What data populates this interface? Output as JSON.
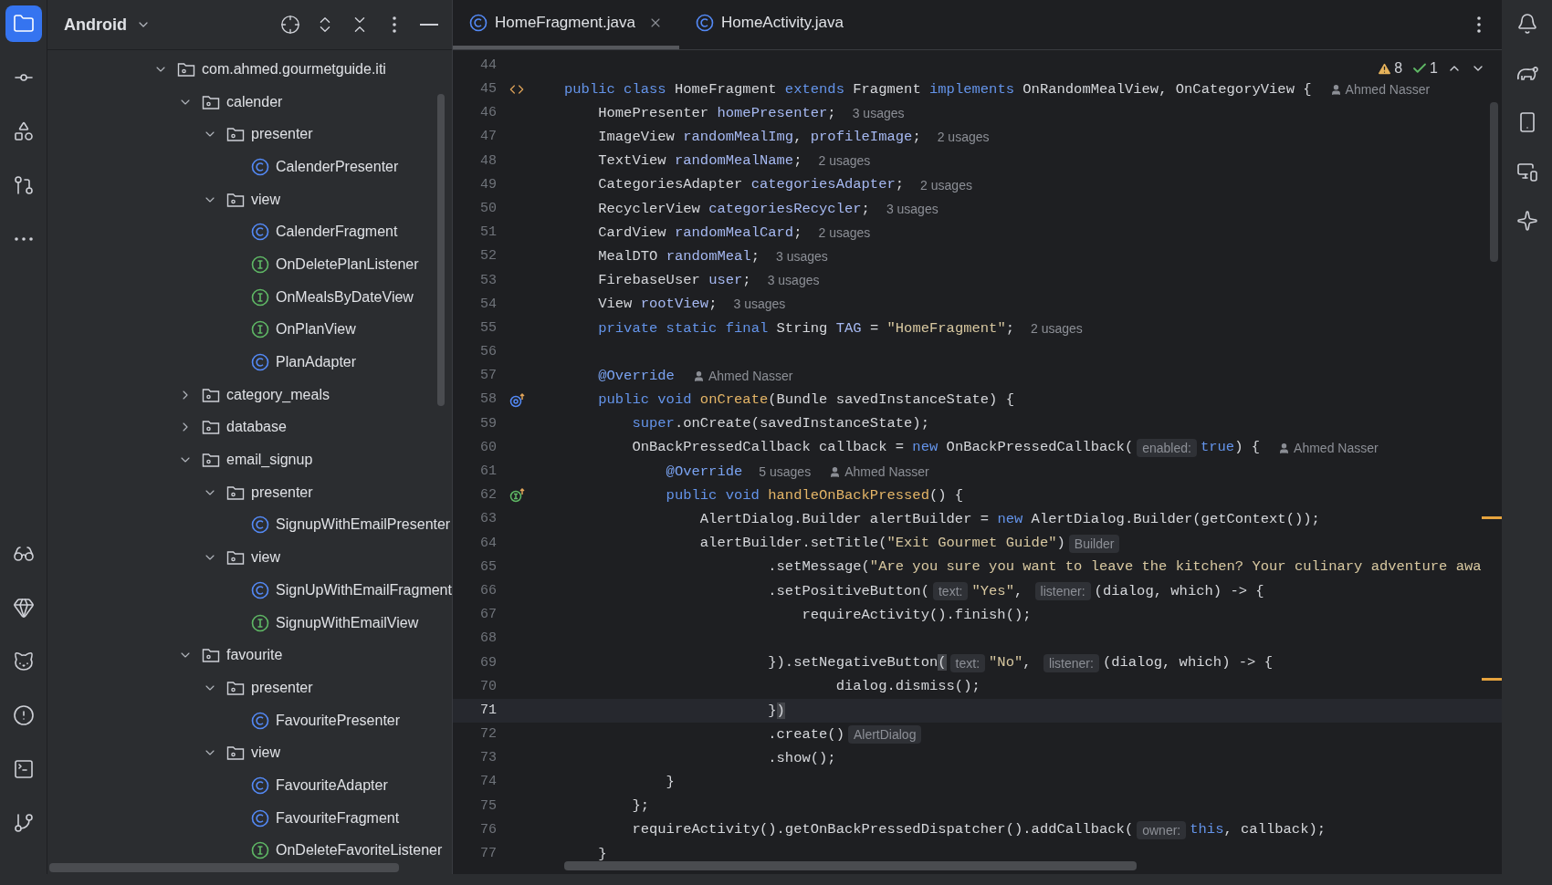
{
  "project_panel": {
    "title": "Android",
    "tree": [
      {
        "label": "com.ahmed.gourmetguide.iti",
        "kind": "folder",
        "expanded": true,
        "children": [
          {
            "label": "calender",
            "kind": "folder",
            "expanded": true,
            "children": [
              {
                "label": "presenter",
                "kind": "folder",
                "expanded": true,
                "children": [
                  {
                    "label": "CalenderPresenter",
                    "kind": "class"
                  }
                ]
              },
              {
                "label": "view",
                "kind": "folder",
                "expanded": true,
                "children": [
                  {
                    "label": "CalenderFragment",
                    "kind": "class"
                  },
                  {
                    "label": "OnDeletePlanListener",
                    "kind": "interface"
                  },
                  {
                    "label": "OnMealsByDateView",
                    "kind": "interface"
                  },
                  {
                    "label": "OnPlanView",
                    "kind": "interface"
                  },
                  {
                    "label": "PlanAdapter",
                    "kind": "class"
                  }
                ]
              }
            ]
          },
          {
            "label": "category_meals",
            "kind": "folder",
            "expanded": false
          },
          {
            "label": "database",
            "kind": "folder",
            "expanded": false
          },
          {
            "label": "email_signup",
            "kind": "folder",
            "expanded": true,
            "children": [
              {
                "label": "presenter",
                "kind": "folder",
                "expanded": true,
                "children": [
                  {
                    "label": "SignupWithEmailPresenter",
                    "kind": "class"
                  }
                ]
              },
              {
                "label": "view",
                "kind": "folder",
                "expanded": true,
                "children": [
                  {
                    "label": "SignUpWithEmailFragment",
                    "kind": "class"
                  },
                  {
                    "label": "SignupWithEmailView",
                    "kind": "interface"
                  }
                ]
              }
            ]
          },
          {
            "label": "favourite",
            "kind": "folder",
            "expanded": true,
            "children": [
              {
                "label": "presenter",
                "kind": "folder",
                "expanded": true,
                "children": [
                  {
                    "label": "FavouritePresenter",
                    "kind": "class"
                  }
                ]
              },
              {
                "label": "view",
                "kind": "folder",
                "expanded": true,
                "children": [
                  {
                    "label": "FavouriteAdapter",
                    "kind": "class"
                  },
                  {
                    "label": "FavouriteFragment",
                    "kind": "class"
                  },
                  {
                    "label": "OnDeleteFavoriteListener",
                    "kind": "interface"
                  }
                ]
              }
            ]
          }
        ]
      }
    ]
  },
  "tabs": [
    {
      "label": "HomeFragment.java",
      "selected": true
    },
    {
      "label": "HomeActivity.java",
      "selected": false
    }
  ],
  "inspections": {
    "warnings": "8",
    "checks": "1"
  },
  "lines": [
    {
      "number": "44",
      "current": false,
      "kind": "plain"
    },
    {
      "number": "45",
      "current": false,
      "kind": "class_declaration",
      "tokens": [
        {
          "kind": "kw",
          "text": "public class "
        },
        {
          "kind": "plain",
          "text": "HomeFragment "
        },
        {
          "kind": "kw",
          "text": "extends "
        },
        {
          "kind": "plain",
          "text": "Fragment "
        },
        {
          "kind": "kw",
          "text": "implements "
        },
        {
          "kind": "plain",
          "text": "OnRandomMealView, OnCategoryView {"
        },
        {
          "kind": "author",
          "text": "Ahmed Nasser"
        }
      ]
    },
    {
      "number": "46",
      "current": false,
      "tokens": [
        {
          "kind": "plain",
          "text": "    HomePresenter "
        },
        {
          "kind": "field",
          "text": "homePresenter"
        },
        {
          "kind": "plain",
          "text": ";"
        },
        {
          "kind": "usage",
          "text": "3 usages"
        }
      ]
    },
    {
      "number": "47",
      "current": false,
      "tokens": [
        {
          "kind": "plain",
          "text": "    ImageView "
        },
        {
          "kind": "field",
          "text": "randomMealImg"
        },
        {
          "kind": "plain",
          "text": ", "
        },
        {
          "kind": "field",
          "text": "profileImage"
        },
        {
          "kind": "plain",
          "text": ";"
        },
        {
          "kind": "usage",
          "text": "2 usages"
        }
      ]
    },
    {
      "number": "48",
      "current": false,
      "tokens": [
        {
          "kind": "plain",
          "text": "    TextView "
        },
        {
          "kind": "field",
          "text": "randomMealName"
        },
        {
          "kind": "plain",
          "text": ";"
        },
        {
          "kind": "usage",
          "text": "2 usages"
        }
      ]
    },
    {
      "number": "49",
      "current": false,
      "tokens": [
        {
          "kind": "plain",
          "text": "    CategoriesAdapter "
        },
        {
          "kind": "field",
          "text": "categoriesAdapter"
        },
        {
          "kind": "plain",
          "text": ";"
        },
        {
          "kind": "usage",
          "text": "2 usages"
        }
      ]
    },
    {
      "number": "50",
      "current": false,
      "tokens": [
        {
          "kind": "plain",
          "text": "    RecyclerView "
        },
        {
          "kind": "field",
          "text": "categoriesRecycler"
        },
        {
          "kind": "plain",
          "text": ";"
        },
        {
          "kind": "usage",
          "text": "3 usages"
        }
      ]
    },
    {
      "number": "51",
      "current": false,
      "tokens": [
        {
          "kind": "plain",
          "text": "    CardView "
        },
        {
          "kind": "field",
          "text": "randomMealCard"
        },
        {
          "kind": "plain",
          "text": ";"
        },
        {
          "kind": "usage",
          "text": "2 usages"
        }
      ]
    },
    {
      "number": "52",
      "current": false,
      "tokens": [
        {
          "kind": "plain",
          "text": "    MealDTO "
        },
        {
          "kind": "field",
          "text": "randomMeal"
        },
        {
          "kind": "plain",
          "text": ";"
        },
        {
          "kind": "usage",
          "text": "3 usages"
        }
      ]
    },
    {
      "number": "53",
      "current": false,
      "tokens": [
        {
          "kind": "plain",
          "text": "    FirebaseUser "
        },
        {
          "kind": "field",
          "text": "user"
        },
        {
          "kind": "plain",
          "text": ";"
        },
        {
          "kind": "usage",
          "text": "3 usages"
        }
      ]
    },
    {
      "number": "54",
      "current": false,
      "tokens": [
        {
          "kind": "plain",
          "text": "    View "
        },
        {
          "kind": "field",
          "text": "rootView"
        },
        {
          "kind": "plain",
          "text": ";"
        },
        {
          "kind": "usage",
          "text": "3 usages"
        }
      ]
    },
    {
      "number": "55",
      "current": false,
      "tokens": [
        {
          "kind": "kw",
          "text": "    private static final "
        },
        {
          "kind": "plain",
          "text": "String "
        },
        {
          "kind": "field",
          "text": "TAG"
        },
        {
          "kind": "plain",
          "text": " = "
        },
        {
          "kind": "str",
          "text": "\"HomeFragment\""
        },
        {
          "kind": "plain",
          "text": ";"
        },
        {
          "kind": "usage",
          "text": "2 usages"
        }
      ]
    },
    {
      "number": "56",
      "current": false,
      "kind": "plain"
    },
    {
      "number": "57",
      "current": false,
      "tokens": [
        {
          "kind": "annotation",
          "text": "    @Override"
        },
        {
          "kind": "author",
          "text": "Ahmed Nasser"
        }
      ]
    },
    {
      "number": "58",
      "current": false,
      "kind": "override",
      "tokens": [
        {
          "kind": "kw",
          "text": "    public void "
        },
        {
          "kind": "method",
          "text": "onCreate"
        },
        {
          "kind": "plain",
          "text": "(Bundle savedInstanceState) {"
        }
      ]
    },
    {
      "number": "59",
      "current": false,
      "tokens": [
        {
          "kind": "kw",
          "text": "        super"
        },
        {
          "kind": "plain",
          "text": ".onCreate(savedInstanceState);"
        }
      ]
    },
    {
      "number": "60",
      "current": false,
      "tokens": [
        {
          "kind": "plain",
          "text": "        OnBackPressedCallback callback = "
        },
        {
          "kind": "kw",
          "text": "new "
        },
        {
          "kind": "plain",
          "text": "OnBackPressedCallback("
        },
        {
          "kind": "hint",
          "text": "enabled:"
        },
        {
          "kind": "kw",
          "text": "true"
        },
        {
          "kind": "plain",
          "text": ") {"
        },
        {
          "kind": "author",
          "text": "Ahmed Nasser"
        }
      ]
    },
    {
      "number": "61",
      "current": false,
      "tokens": [
        {
          "kind": "annotation",
          "text": "            @Override"
        },
        {
          "kind": "usage",
          "text": "5 usages"
        },
        {
          "kind": "author",
          "text": "Ahmed Nasser"
        }
      ]
    },
    {
      "number": "62",
      "current": false,
      "kind": "implements",
      "tokens": [
        {
          "kind": "kw",
          "text": "            public void "
        },
        {
          "kind": "method",
          "text": "handleOnBackPressed"
        },
        {
          "kind": "plain",
          "text": "() {"
        }
      ]
    },
    {
      "number": "63",
      "current": false,
      "tokens": [
        {
          "kind": "plain",
          "text": "                AlertDialog.Builder alertBuilder = "
        },
        {
          "kind": "kw",
          "text": "new "
        },
        {
          "kind": "plain",
          "text": "AlertDialog.Builder(getContext());"
        }
      ]
    },
    {
      "number": "64",
      "current": false,
      "tokens": [
        {
          "kind": "plain",
          "text": "                alertBuilder.setTitle("
        },
        {
          "kind": "str",
          "text": "\"Exit Gourmet Guide\""
        },
        {
          "kind": "plain",
          "text": ")"
        },
        {
          "kind": "hint",
          "text": "Builder"
        }
      ]
    },
    {
      "number": "65",
      "current": false,
      "tokens": [
        {
          "kind": "plain",
          "text": "                        .setMessage("
        },
        {
          "kind": "str",
          "text": "\"Are you sure you want to leave the kitchen? Your culinary adventure awa"
        }
      ]
    },
    {
      "number": "66",
      "current": false,
      "tokens": [
        {
          "kind": "plain",
          "text": "                        .setPositiveButton("
        },
        {
          "kind": "hint",
          "text": "text:"
        },
        {
          "kind": "str",
          "text": "\"Yes\""
        },
        {
          "kind": "plain",
          "text": ", "
        },
        {
          "kind": "hint",
          "text": "listener:"
        },
        {
          "kind": "plain",
          "text": "(dialog, which) -> {"
        }
      ]
    },
    {
      "number": "67",
      "current": false,
      "tokens": [
        {
          "kind": "plain",
          "text": "                            requireActivity().finish();"
        }
      ]
    },
    {
      "number": "68",
      "current": false,
      "kind": "plain"
    },
    {
      "number": "69",
      "current": false,
      "tokens": [
        {
          "kind": "plain",
          "text": "                        }).setNegativeButton"
        },
        {
          "kind": "match",
          "text": "("
        },
        {
          "kind": "hint",
          "text": "text:"
        },
        {
          "kind": "str",
          "text": "\"No\""
        },
        {
          "kind": "plain",
          "text": ", "
        },
        {
          "kind": "hint",
          "text": "listener:"
        },
        {
          "kind": "plain",
          "text": "(dialog, which) -> {"
        }
      ]
    },
    {
      "number": "70",
      "current": false,
      "tokens": [
        {
          "kind": "plain",
          "text": "                                dialog.dismiss();"
        }
      ]
    },
    {
      "number": "71",
      "current": true,
      "tokens": [
        {
          "kind": "plain",
          "text": "                        }"
        },
        {
          "kind": "match",
          "text": ")"
        }
      ]
    },
    {
      "number": "72",
      "current": false,
      "tokens": [
        {
          "kind": "plain",
          "text": "                        .create()"
        },
        {
          "kind": "hint",
          "text": "AlertDialog"
        }
      ]
    },
    {
      "number": "73",
      "current": false,
      "tokens": [
        {
          "kind": "plain",
          "text": "                        .show();"
        }
      ]
    },
    {
      "number": "74",
      "current": false,
      "tokens": [
        {
          "kind": "plain",
          "text": "            }"
        }
      ]
    },
    {
      "number": "75",
      "current": false,
      "tokens": [
        {
          "kind": "plain",
          "text": "        };"
        }
      ]
    },
    {
      "number": "76",
      "current": false,
      "tokens": [
        {
          "kind": "plain",
          "text": "        requireActivity().getOnBackPressedDispatcher().addCallback("
        },
        {
          "kind": "hint",
          "text": "owner:"
        },
        {
          "kind": "kw",
          "text": "this"
        },
        {
          "kind": "plain",
          "text": ", callback);"
        }
      ]
    },
    {
      "number": "77",
      "current": false,
      "tokens": [
        {
          "kind": "plain",
          "text": "    }"
        }
      ]
    }
  ]
}
